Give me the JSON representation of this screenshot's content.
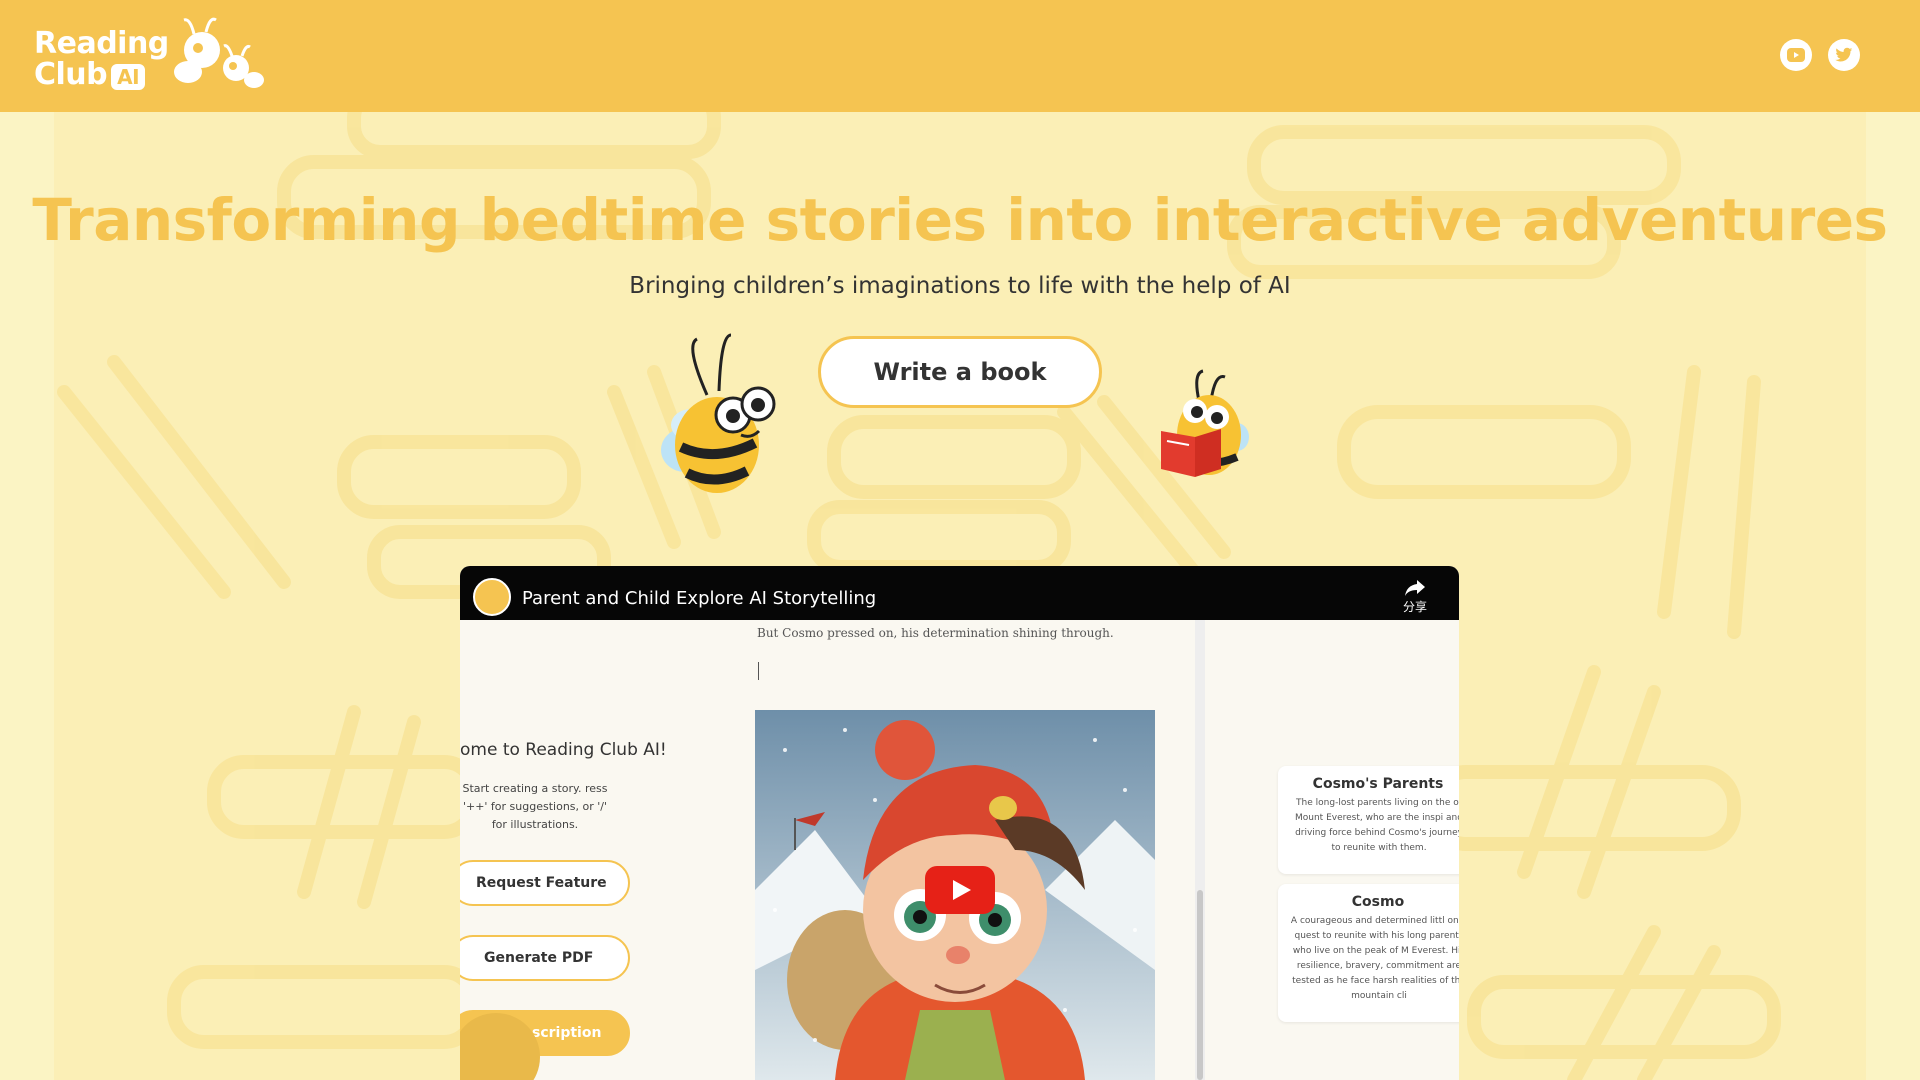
{
  "header": {
    "logo_line1": "Reading",
    "logo_line2": "Club",
    "logo_badge": "AI",
    "brand_color": "#f5c451",
    "social": [
      "youtube-icon",
      "twitter-icon"
    ]
  },
  "hero": {
    "headline": "Transforming bedtime stories into interactive adventures",
    "subline": "Bringing children’s imaginations to life with the help of AI",
    "cta_label": "Write a book"
  },
  "video": {
    "title": "Parent and Child Explore AI Storytelling",
    "share_label": "分享",
    "app": {
      "welcome": "ome to Reading Club AI!",
      "hint_lines": "Start creating a story. ress '++' for suggestions, or '/' for illustrations.",
      "request_feature": "Request Feature",
      "generate_pdf": "Generate PDF",
      "subscription": "ubscription",
      "doc_line": "But Cosmo pressed on, his determination shining through.",
      "cards": [
        {
          "title": "Cosmo's Parents",
          "body": "The long-lost parents living on the of Mount Everest, who are the inspi and driving force behind Cosmo's journey to reunite with them."
        },
        {
          "title": "Cosmo",
          "body": "A courageous and determined littl on a quest to reunite with his long parents who live on the peak of M Everest. His resilience, bravery, commitment are tested as he face harsh realities of the mountain cli"
        }
      ]
    }
  }
}
